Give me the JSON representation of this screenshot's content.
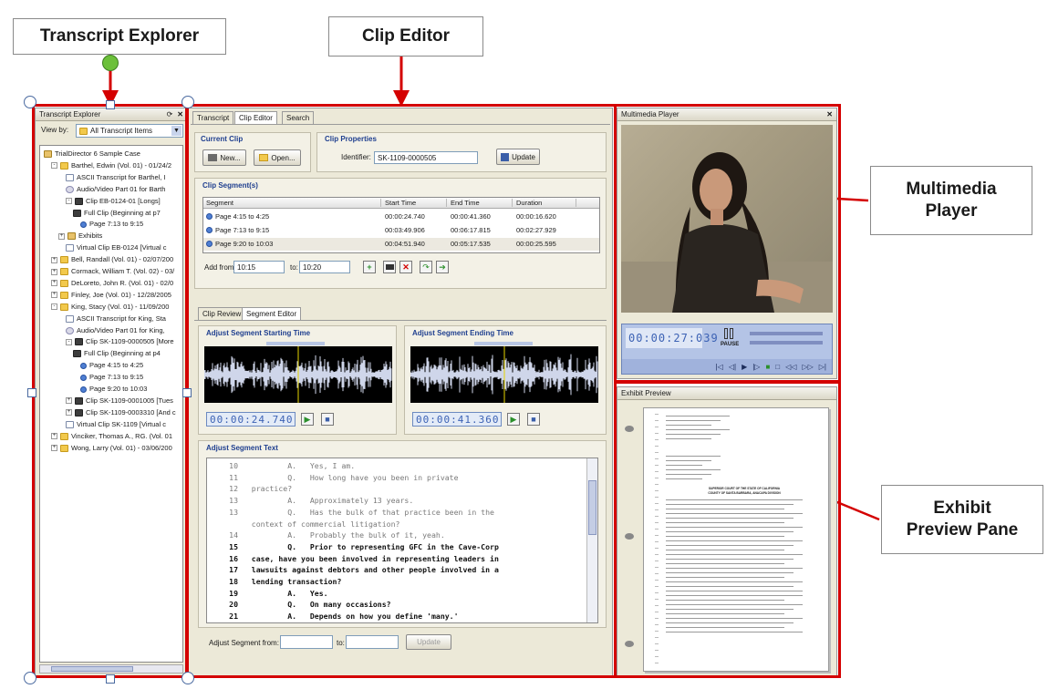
{
  "callouts": {
    "transcript_explorer": "Transcript Explorer",
    "clip_editor": "Clip Editor",
    "multimedia_player": "Multimedia Player",
    "exhibit_preview": "Exhibit Preview Pane"
  },
  "explorer": {
    "title": "Transcript Explorer",
    "view_by_label": "View by:",
    "view_by_value": "All Transcript Items",
    "items": [
      {
        "label": "TrialDirector 6 Sample Case",
        "icon": "case-icon"
      },
      {
        "label": "Barthel, Edwin (Vol. 01) - 01/24/2",
        "icon": "folder-icon"
      },
      {
        "label": "ASCII Transcript for Barthel, I",
        "icon": "document-icon"
      },
      {
        "label": "Audio/Video Part 01 for Barth",
        "icon": "audio-video-icon"
      },
      {
        "label": "Clip EB-0124-01 [Longs]",
        "icon": "clip-icon"
      },
      {
        "label": "Full Clip (Beginning at p7",
        "icon": "clip-icon"
      },
      {
        "label": "Page 7:13 to 9:15",
        "icon": "page-icon"
      },
      {
        "label": "Exhibits",
        "icon": "exhibits-icon"
      },
      {
        "label": "Virtual Clip EB-0124 [Virtual c",
        "icon": "virtual-clip-icon"
      },
      {
        "label": "Bell, Randall (Vol. 01) - 02/07/200",
        "icon": "folder-icon"
      },
      {
        "label": "Cormack, William T. (Vol. 02) - 03/",
        "icon": "folder-icon"
      },
      {
        "label": "DeLoreto, John R. (Vol. 01) - 02/0",
        "icon": "folder-icon"
      },
      {
        "label": "Finley, Joe (Vol. 01) - 12/28/2005",
        "icon": "folder-icon"
      },
      {
        "label": "King, Stacy (Vol. 01) - 11/09/200",
        "icon": "folder-icon"
      },
      {
        "label": "ASCII Transcript for King, Sta",
        "icon": "document-icon"
      },
      {
        "label": "Audio/Video Part 01 for King,",
        "icon": "audio-video-icon"
      },
      {
        "label": "Clip SK-1109-0000505 [More",
        "icon": "clip-icon"
      },
      {
        "label": "Full Clip (Beginning at p4",
        "icon": "clip-icon"
      },
      {
        "label": "Page 4:15 to 4:25",
        "icon": "page-icon"
      },
      {
        "label": "Page 7:13 to 9:15",
        "icon": "page-icon"
      },
      {
        "label": "Page 9:20 to 10:03",
        "icon": "page-icon"
      },
      {
        "label": "Clip SK-1109-0001005 [Tues",
        "icon": "clip-icon"
      },
      {
        "label": "Clip SK-1109-0003310 [And c",
        "icon": "clip-icon"
      },
      {
        "label": "Virtual Clip SK-1109 [Virtual c",
        "icon": "virtual-clip-icon"
      },
      {
        "label": "Vinciker, Thomas A., RG. (Vol. 01",
        "icon": "folder-icon"
      },
      {
        "label": "Wong, Larry (Vol. 01) - 03/06/200",
        "icon": "folder-icon"
      }
    ]
  },
  "tabs": [
    "Transcript",
    "Clip Editor",
    "Search"
  ],
  "current_clip": {
    "title": "Current Clip",
    "new_label": "New...",
    "open_label": "Open..."
  },
  "clip_properties": {
    "title": "Clip Properties",
    "identifier_label": "Identifier:",
    "identifier_value": "SK-1109-0000505",
    "update_label": "Update"
  },
  "segments": {
    "title": "Clip Segment(s)",
    "columns": [
      "Segment",
      "Start Time",
      "End Time",
      "Duration"
    ],
    "rows": [
      [
        "Page 4:15 to 4:25",
        "00:00:24.740",
        "00:00:41.360",
        "00:00:16.620"
      ],
      [
        "Page 7:13 to 9:15",
        "00:03:49.906",
        "00:06:17.815",
        "00:02:27.929"
      ],
      [
        "Page 9:20 to 10:03",
        "00:04:51.940",
        "00:05:17.535",
        "00:00:25.595"
      ]
    ],
    "add_from_label": "Add from:",
    "add_from_value": "10:15",
    "to_label": "to:",
    "to_value": "10:20"
  },
  "sub_tabs": [
    "Clip Review",
    "Segment Editor"
  ],
  "adjust_start": {
    "title": "Adjust Segment Starting Time",
    "time": "00:00:24.740"
  },
  "adjust_end": {
    "title": "Adjust Segment Ending Time",
    "time": "00:00:41.360"
  },
  "segment_text": {
    "title": "Adjust Segment Text",
    "lines": [
      {
        "n": "10",
        "t": "           A.   Yes, I am.",
        "bold": false
      },
      {
        "n": "11",
        "t": "           Q.   How long have you been in private",
        "bold": false
      },
      {
        "n": "12",
        "t": "   practice?",
        "bold": false
      },
      {
        "n": "13",
        "t": "           A.   Approximately 13 years.",
        "bold": false
      },
      {
        "n": "13",
        "t": "           Q.   Has the bulk of that practice been in the",
        "bold": false
      },
      {
        "n": "",
        "t": "   context of commercial litigation?",
        "bold": false
      },
      {
        "n": "14",
        "t": "           A.   Probably the bulk of it, yeah.",
        "bold": false
      },
      {
        "n": "15",
        "t": "           Q.   Prior to representing GFC in the Cave-Corp",
        "bold": true
      },
      {
        "n": "16",
        "t": "   case, have you been involved in representing leaders in",
        "bold": true
      },
      {
        "n": "17",
        "t": "   lawsuits against debtors and other people involved in a",
        "bold": true
      },
      {
        "n": "18",
        "t": "   lending transaction?",
        "bold": true
      },
      {
        "n": "19",
        "t": "           A.   Yes.",
        "bold": true
      },
      {
        "n": "20",
        "t": "           Q.   On many occasions?",
        "bold": true
      },
      {
        "n": "21",
        "t": "           A.   Depends on how you define 'many.'",
        "bold": true
      }
    ],
    "adjust_from_label": "Adjust Segment from:",
    "to_label": "to:",
    "update_label": "Update"
  },
  "player": {
    "title": "Multimedia Player",
    "time": "00:00:27:039",
    "pause_label": "PAUSE"
  },
  "exhibit": {
    "title": "Exhibit Preview",
    "court_title_1": "SUPERIOR COURT OF THE STATE OF CALIFORNIA",
    "court_title_2": "COUNTY OF SANTA BARBARA, ANACAPA DIVISION"
  }
}
